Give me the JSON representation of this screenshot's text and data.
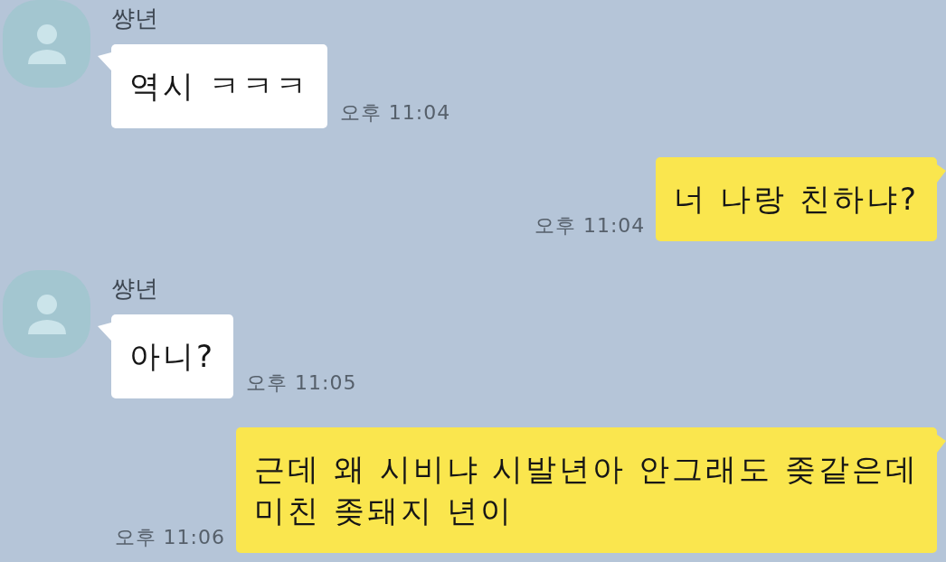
{
  "messages": [
    {
      "kind": "received",
      "sender": "썅년",
      "text": "역시 ㅋㅋㅋ",
      "time": "오후 11:04"
    },
    {
      "kind": "sent",
      "text": "너 나랑 친하냐?",
      "time": "오후 11:04"
    },
    {
      "kind": "received",
      "sender": "썅년",
      "text": "아니?",
      "time": "오후 11:05"
    },
    {
      "kind": "sent",
      "text": "근데 왜 시비냐 시발년아 안그래도 좆같은데\n미친 좆돼지 년이",
      "time": "오후 11:06"
    }
  ]
}
